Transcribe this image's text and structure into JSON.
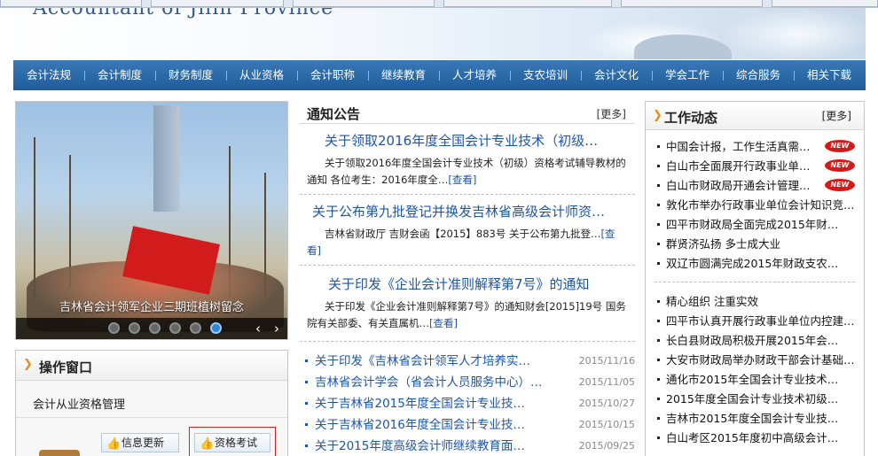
{
  "header": {
    "title_en": "Accountant of Jilin Province"
  },
  "nav": [
    "会计法规",
    "会计制度",
    "财务制度",
    "从业资格",
    "会计职称",
    "继续教育",
    "人才培养",
    "支农培训",
    "会计文化",
    "学会工作",
    "综合服务",
    "相关下载"
  ],
  "carousel": {
    "caption": "吉林省会计领军企业三期班植树留念",
    "prev": "‹",
    "next": "›"
  },
  "ops": {
    "title": "操作窗口",
    "subtitle": "会计从业资格管理",
    "btn_info": "信息更新",
    "btn_exam": "资格考试"
  },
  "notice": {
    "title": "通知公告",
    "more": "[更多]",
    "featured": [
      {
        "title": "关于领取2016年度全国会计专业技术（初级…",
        "desc": "关于领取2016年度全国会计专业技术（初级）资格考试辅导教材的通知 各位考生：2016年度全…",
        "view": "[查看]"
      },
      {
        "title": "关于公布第九批登记并换发吉林省高级会计师资…",
        "desc": "吉林省财政厅 吉财会函【2015】883号 关于公布第九批登…",
        "view": "[查看]"
      },
      {
        "title": "关于印发《企业会计准则解释第7号》的通知",
        "desc": "关于印发《企业会计准则解释第7号》的通知财会[2015]19号 国务院有关部委、有关直属机…",
        "view": "[查看]"
      }
    ],
    "list": [
      {
        "title": "关于印发《吉林省会计领军人才培养实…",
        "date": "2015/11/16"
      },
      {
        "title": "吉林省会计学会（省会计人员服务中心）…",
        "date": "2015/11/05"
      },
      {
        "title": "关于吉林省2015年度全国会计专业技…",
        "date": "2015/10/27"
      },
      {
        "title": "关于吉林省2016年度全国会计专业技…",
        "date": "2015/10/15"
      },
      {
        "title": "关于2015年度高级会计师继续教育面…",
        "date": "2015/09/25"
      }
    ]
  },
  "work": {
    "title": "工作动态",
    "more": "[更多]",
    "new_label": "NEW",
    "items_top": [
      {
        "title": "中国会计报，工作生活真需…",
        "is_new": true
      },
      {
        "title": "白山市全面展开行政事业单…",
        "is_new": true
      },
      {
        "title": "白山市财政局开通会计管理…",
        "is_new": true
      },
      {
        "title": "敦化市举办行政事业单位会计知识竞…",
        "is_new": false
      },
      {
        "title": "四平市财政局全面完成2015年财…",
        "is_new": false
      },
      {
        "title": "群贤济弘扬 多士成大业",
        "is_new": false
      },
      {
        "title": "双辽市圆满完成2015年财政支农…",
        "is_new": false
      }
    ],
    "items_bottom": [
      {
        "title": "精心组织 注重实效"
      },
      {
        "title": "四平市认真开展行政事业单位内控建…"
      },
      {
        "title": "长白县财政局积极开展2015年会…"
      },
      {
        "title": "大安市财政局举办财政干部会计基础…"
      },
      {
        "title": "通化市2015年全国会计专业技术…"
      },
      {
        "title": "2015年度全国会计专业技术初级…"
      },
      {
        "title": "吉林市2015年度全国会计专业技…"
      },
      {
        "title": "白山考区2015年度初中高级会计…"
      }
    ]
  },
  "colors": {
    "nav_bg": "#1f5c9b",
    "link": "#1c55b0",
    "accent": "#e78b17",
    "new_badge": "#d71818"
  }
}
